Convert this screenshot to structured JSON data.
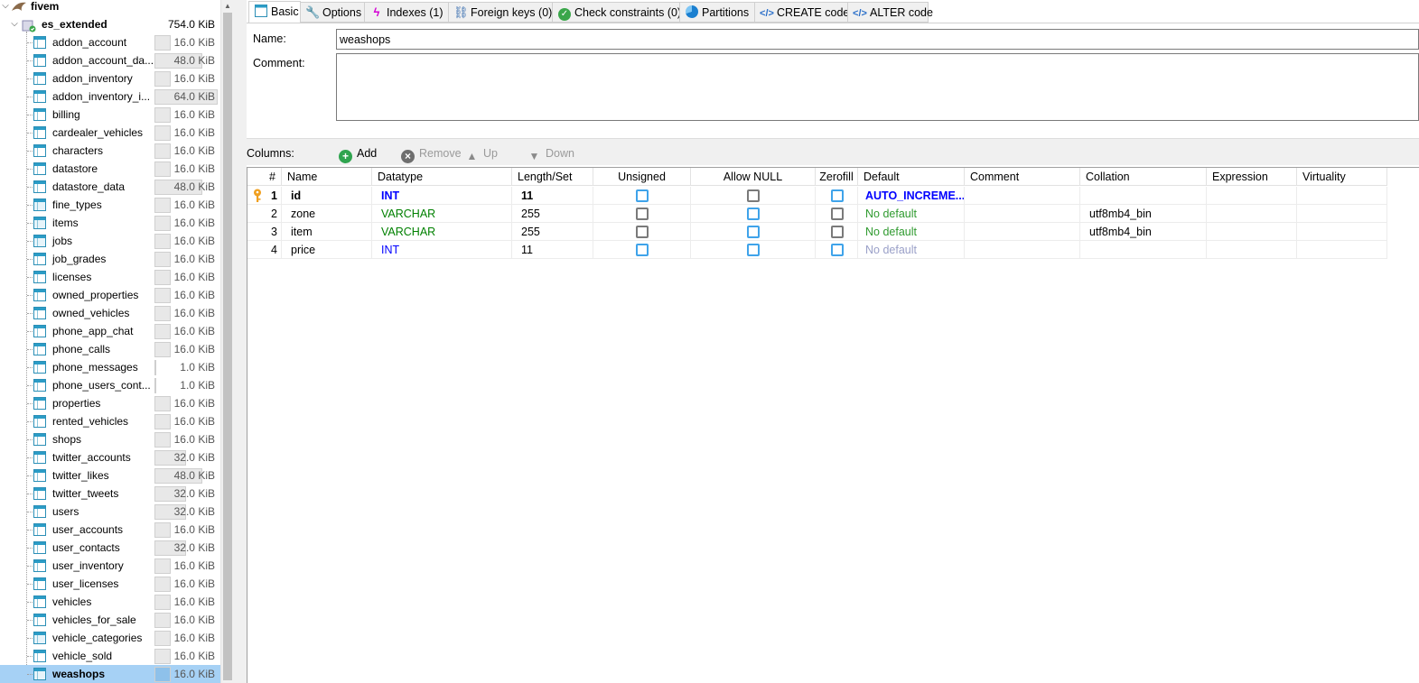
{
  "tree": {
    "server": "fivem",
    "database": {
      "name": "es_extended",
      "size": "754.0 KiB"
    },
    "tables": [
      {
        "name": "addon_account",
        "size": "16.0 KiB",
        "fill": 0.25
      },
      {
        "name": "addon_account_da...",
        "size": "48.0 KiB",
        "fill": 0.75
      },
      {
        "name": "addon_inventory",
        "size": "16.0 KiB",
        "fill": 0.25
      },
      {
        "name": "addon_inventory_i...",
        "size": "64.0 KiB",
        "fill": 1.0
      },
      {
        "name": "billing",
        "size": "16.0 KiB",
        "fill": 0.25
      },
      {
        "name": "cardealer_vehicles",
        "size": "16.0 KiB",
        "fill": 0.25
      },
      {
        "name": "characters",
        "size": "16.0 KiB",
        "fill": 0.25
      },
      {
        "name": "datastore",
        "size": "16.0 KiB",
        "fill": 0.25
      },
      {
        "name": "datastore_data",
        "size": "48.0 KiB",
        "fill": 0.75
      },
      {
        "name": "fine_types",
        "size": "16.0 KiB",
        "fill": 0.25
      },
      {
        "name": "items",
        "size": "16.0 KiB",
        "fill": 0.25
      },
      {
        "name": "jobs",
        "size": "16.0 KiB",
        "fill": 0.25
      },
      {
        "name": "job_grades",
        "size": "16.0 KiB",
        "fill": 0.25
      },
      {
        "name": "licenses",
        "size": "16.0 KiB",
        "fill": 0.25
      },
      {
        "name": "owned_properties",
        "size": "16.0 KiB",
        "fill": 0.25
      },
      {
        "name": "owned_vehicles",
        "size": "16.0 KiB",
        "fill": 0.25
      },
      {
        "name": "phone_app_chat",
        "size": "16.0 KiB",
        "fill": 0.25
      },
      {
        "name": "phone_calls",
        "size": "16.0 KiB",
        "fill": 0.25
      },
      {
        "name": "phone_messages",
        "size": "1.0 KiB",
        "fill": 0.02
      },
      {
        "name": "phone_users_cont...",
        "size": "1.0 KiB",
        "fill": 0.02
      },
      {
        "name": "properties",
        "size": "16.0 KiB",
        "fill": 0.25
      },
      {
        "name": "rented_vehicles",
        "size": "16.0 KiB",
        "fill": 0.25
      },
      {
        "name": "shops",
        "size": "16.0 KiB",
        "fill": 0.25
      },
      {
        "name": "twitter_accounts",
        "size": "32.0 KiB",
        "fill": 0.5
      },
      {
        "name": "twitter_likes",
        "size": "48.0 KiB",
        "fill": 0.75
      },
      {
        "name": "twitter_tweets",
        "size": "32.0 KiB",
        "fill": 0.5
      },
      {
        "name": "users",
        "size": "32.0 KiB",
        "fill": 0.5
      },
      {
        "name": "user_accounts",
        "size": "16.0 KiB",
        "fill": 0.25
      },
      {
        "name": "user_contacts",
        "size": "32.0 KiB",
        "fill": 0.5
      },
      {
        "name": "user_inventory",
        "size": "16.0 KiB",
        "fill": 0.25
      },
      {
        "name": "user_licenses",
        "size": "16.0 KiB",
        "fill": 0.25
      },
      {
        "name": "vehicles",
        "size": "16.0 KiB",
        "fill": 0.25
      },
      {
        "name": "vehicles_for_sale",
        "size": "16.0 KiB",
        "fill": 0.25
      },
      {
        "name": "vehicle_categories",
        "size": "16.0 KiB",
        "fill": 0.25
      },
      {
        "name": "vehicle_sold",
        "size": "16.0 KiB",
        "fill": 0.25
      },
      {
        "name": "weashops",
        "size": "16.0 KiB",
        "fill": 0.25
      }
    ],
    "selected_table": "weashops"
  },
  "tabs": [
    {
      "label": "Basic",
      "icon": "table-icon"
    },
    {
      "label": "Options",
      "icon": "wrench-icon"
    },
    {
      "label": "Indexes (1)",
      "icon": "lightning-icon"
    },
    {
      "label": "Foreign keys (0)",
      "icon": "foreign-key-icon"
    },
    {
      "label": "Check constraints (0)",
      "icon": "check-icon"
    },
    {
      "label": "Partitions",
      "icon": "pie-icon"
    },
    {
      "label": "CREATE code",
      "icon": "code-icon"
    },
    {
      "label": "ALTER code",
      "icon": "code-icon"
    }
  ],
  "form": {
    "name_label": "Name:",
    "name_value": "weashops",
    "comment_label": "Comment:",
    "comment_value": ""
  },
  "columns_toolbar": {
    "label": "Columns:",
    "add": "Add",
    "remove": "Remove",
    "up": "Up",
    "down": "Down"
  },
  "grid": {
    "headers": [
      "#",
      "Name",
      "Datatype",
      "Length/Set",
      "Unsigned",
      "Allow NULL",
      "Zerofill",
      "Default",
      "Comment",
      "Collation",
      "Expression",
      "Virtuality"
    ],
    "rows": [
      {
        "num": "1",
        "name": "id",
        "datatype": "INT",
        "length": "11",
        "unsigned": false,
        "allow_null": false,
        "zerofill": false,
        "default": "AUTO_INCREME...",
        "comment": "",
        "collation": "",
        "expression": "",
        "virtuality": "",
        "primary_key": true
      },
      {
        "num": "2",
        "name": "zone",
        "datatype": "VARCHAR",
        "length": "255",
        "unsigned": false,
        "allow_null": false,
        "zerofill": false,
        "default": "No default",
        "comment": "",
        "collation": "utf8mb4_bin",
        "expression": "",
        "virtuality": "",
        "primary_key": false
      },
      {
        "num": "3",
        "name": "item",
        "datatype": "VARCHAR",
        "length": "255",
        "unsigned": false,
        "allow_null": false,
        "zerofill": false,
        "default": "No default",
        "comment": "",
        "collation": "utf8mb4_bin",
        "expression": "",
        "virtuality": "",
        "primary_key": false
      },
      {
        "num": "4",
        "name": "price",
        "datatype": "INT",
        "length": "11",
        "unsigned": false,
        "allow_null": false,
        "zerofill": false,
        "default": "No default",
        "comment": "",
        "collation": "",
        "expression": "",
        "virtuality": "",
        "primary_key": false
      }
    ]
  },
  "colors": {
    "int_type": "#0000ff",
    "varchar_type": "#008000",
    "no_default": "#2f9a2f",
    "selected_row": "#a6d1f5"
  }
}
